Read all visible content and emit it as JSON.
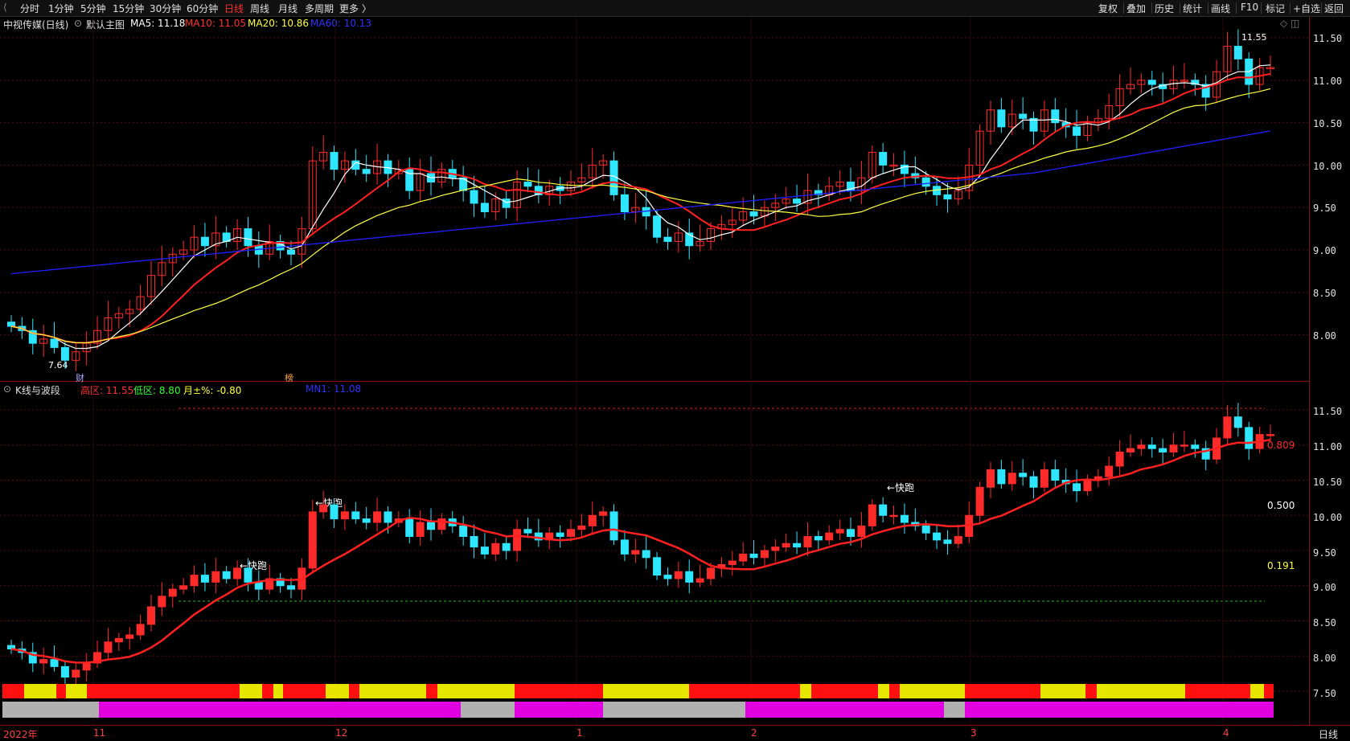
{
  "topbar": {
    "periods": [
      "分时",
      "1分钟",
      "5分钟",
      "15分钟",
      "30分钟",
      "60分钟",
      "日线",
      "周线",
      "月线",
      "多周期",
      "更多 〉"
    ],
    "active_period": "日线",
    "tools": [
      "复权",
      "叠加",
      "历史",
      "统计",
      "画线",
      "F10",
      "标记",
      "+自选",
      "返回"
    ]
  },
  "main_chart": {
    "stock_title": "中视传媒(日线)",
    "indicator_name": "默认主图",
    "ma5": "MA5: 11.18",
    "ma10": "MA10: 11.05",
    "ma20": "MA20: 10.86",
    "ma60": "MA60: 10.13",
    "high_marker": "11.55",
    "low_marker": "7.64",
    "markers": [
      "财",
      "榜"
    ],
    "y_labels": [
      "11.50",
      "11.00",
      "10.50",
      "10.00",
      "9.50",
      "9.00",
      "8.50",
      "8.00"
    ]
  },
  "sub_chart": {
    "title": "K线与波段",
    "high_zone": "高区: 11.55",
    "low_zone": "低区: 8.80",
    "month_pct": "月±%: -0.80",
    "mn1": "MN1: 11.08",
    "fib_levels": [
      "0.809",
      "0.500",
      "0.191"
    ],
    "annotations": [
      "←快跑",
      "←快跑",
      "←快跑"
    ],
    "y_labels": [
      "11.50",
      "11.00",
      "10.50",
      "10.00",
      "9.50",
      "9.00",
      "8.50",
      "8.00",
      "7.50"
    ]
  },
  "x_axis": {
    "labels": [
      "2022年",
      "11",
      "12",
      "1",
      "2",
      "3",
      "4"
    ],
    "period_label": "日线"
  },
  "colors": {
    "up": "#ff2a2a",
    "down": "#2ee6ff",
    "ma5": "#ffffff",
    "ma10": "#ff2020",
    "ma20": "#ffff40",
    "ma60": "#2020ff",
    "magenta": "#e000e0",
    "gray": "#b0b0b0",
    "yellow": "#e6e600"
  },
  "chart_data": {
    "type": "candlestick",
    "closes": [
      8.1,
      8.05,
      7.9,
      7.95,
      7.85,
      7.7,
      7.8,
      7.9,
      8.05,
      8.2,
      8.25,
      8.3,
      8.45,
      8.7,
      8.85,
      8.95,
      9.0,
      9.15,
      9.05,
      9.2,
      9.1,
      9.25,
      9.05,
      8.95,
      9.1,
      9.0,
      8.95,
      9.25,
      10.05,
      10.15,
      9.95,
      10.05,
      9.95,
      9.9,
      10.05,
      9.9,
      9.95,
      9.7,
      9.9,
      9.8,
      9.95,
      9.85,
      9.7,
      9.55,
      9.45,
      9.6,
      9.5,
      9.8,
      9.75,
      9.65,
      9.75,
      9.7,
      9.8,
      9.85,
      10.0,
      10.05,
      9.65,
      9.45,
      9.5,
      9.4,
      9.15,
      9.1,
      9.2,
      9.05,
      9.1,
      9.25,
      9.3,
      9.35,
      9.45,
      9.4,
      9.5,
      9.55,
      9.6,
      9.55,
      9.7,
      9.65,
      9.75,
      9.8,
      9.7,
      9.85,
      10.15,
      10.0,
      10.0,
      9.9,
      9.85,
      9.75,
      9.65,
      9.6,
      9.7,
      10.0,
      10.4,
      10.65,
      10.45,
      10.6,
      10.55,
      10.4,
      10.65,
      10.5,
      10.45,
      10.35,
      10.5,
      10.55,
      10.7,
      10.9,
      10.95,
      11.0,
      10.95,
      10.9,
      11.0,
      11.0,
      10.95,
      10.8,
      11.1,
      11.4,
      11.25,
      10.95,
      11.15,
      11.15
    ]
  }
}
